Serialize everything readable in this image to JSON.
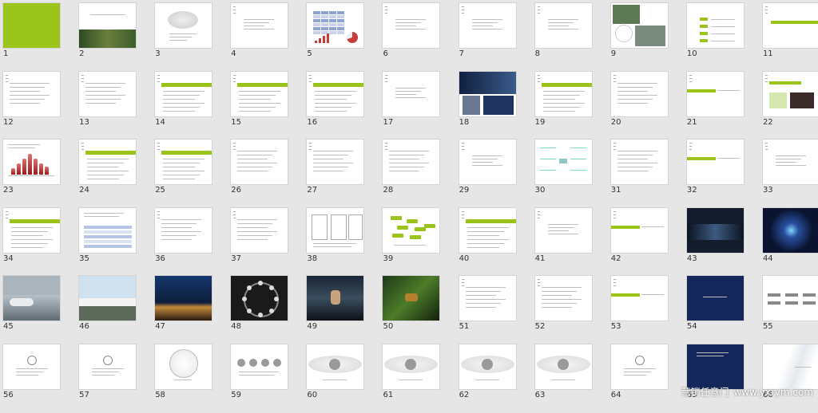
{
  "slides": [
    {
      "num": "1",
      "kind": "green"
    },
    {
      "num": "2",
      "kind": "cover-photo"
    },
    {
      "num": "3",
      "kind": "eye"
    },
    {
      "num": "4",
      "kind": "text-center"
    },
    {
      "num": "5",
      "kind": "table-chart"
    },
    {
      "num": "6",
      "kind": "text-center"
    },
    {
      "num": "7",
      "kind": "text-center"
    },
    {
      "num": "8",
      "kind": "text-center"
    },
    {
      "num": "9",
      "kind": "photo-collage"
    },
    {
      "num": "10",
      "kind": "contents"
    },
    {
      "num": "11",
      "kind": "bar-right"
    },
    {
      "num": "12",
      "kind": "text-left"
    },
    {
      "num": "13",
      "kind": "text-left"
    },
    {
      "num": "14",
      "kind": "title-bar"
    },
    {
      "num": "15",
      "kind": "title-bar"
    },
    {
      "num": "16",
      "kind": "title-bar"
    },
    {
      "num": "17",
      "kind": "text-center"
    },
    {
      "num": "18",
      "kind": "photo-collage-blue"
    },
    {
      "num": "19",
      "kind": "title-bar"
    },
    {
      "num": "20",
      "kind": "text-left"
    },
    {
      "num": "21",
      "kind": "bar-left"
    },
    {
      "num": "22",
      "kind": "title-bar-img"
    },
    {
      "num": "23",
      "kind": "red-chart"
    },
    {
      "num": "24",
      "kind": "title-bar"
    },
    {
      "num": "25",
      "kind": "title-bar"
    },
    {
      "num": "26",
      "kind": "text-left"
    },
    {
      "num": "27",
      "kind": "text-left"
    },
    {
      "num": "28",
      "kind": "text-left"
    },
    {
      "num": "29",
      "kind": "text-center"
    },
    {
      "num": "30",
      "kind": "mindmap"
    },
    {
      "num": "31",
      "kind": "text-left"
    },
    {
      "num": "32",
      "kind": "bar-left"
    },
    {
      "num": "33",
      "kind": "text-center"
    },
    {
      "num": "34",
      "kind": "title-bar"
    },
    {
      "num": "35",
      "kind": "table-blue"
    },
    {
      "num": "36",
      "kind": "text-left"
    },
    {
      "num": "37",
      "kind": "text-left"
    },
    {
      "num": "38",
      "kind": "diagram"
    },
    {
      "num": "39",
      "kind": "green-boxes"
    },
    {
      "num": "40",
      "kind": "title-bar"
    },
    {
      "num": "41",
      "kind": "text-center"
    },
    {
      "num": "42",
      "kind": "bar-left"
    },
    {
      "num": "43",
      "kind": "dark-photo"
    },
    {
      "num": "44",
      "kind": "dark-light"
    },
    {
      "num": "45",
      "kind": "car-photo"
    },
    {
      "num": "46",
      "kind": "train-photo"
    },
    {
      "num": "47",
      "kind": "night-photo"
    },
    {
      "num": "48",
      "kind": "clock"
    },
    {
      "num": "49",
      "kind": "spa-photo"
    },
    {
      "num": "50",
      "kind": "jungle-photo"
    },
    {
      "num": "51",
      "kind": "text-left"
    },
    {
      "num": "52",
      "kind": "text-left"
    },
    {
      "num": "53",
      "kind": "bar-left"
    },
    {
      "num": "54",
      "kind": "navy"
    },
    {
      "num": "55",
      "kind": "logos"
    },
    {
      "num": "56",
      "kind": "logo-center"
    },
    {
      "num": "57",
      "kind": "logo-center"
    },
    {
      "num": "58",
      "kind": "emblem"
    },
    {
      "num": "59",
      "kind": "four-circles"
    },
    {
      "num": "60",
      "kind": "gray-ellipse"
    },
    {
      "num": "61",
      "kind": "gray-ellipse"
    },
    {
      "num": "62",
      "kind": "gray-ellipse"
    },
    {
      "num": "63",
      "kind": "gray-ellipse"
    },
    {
      "num": "64",
      "kind": "logo-center"
    },
    {
      "num": "65",
      "kind": "navy-text"
    },
    {
      "num": "66",
      "kind": "white-curve"
    }
  ],
  "watermark": {
    "brand": "营销任意门",
    "url": "www.yxrym.com"
  },
  "colors": {
    "accent": "#9bc41b",
    "background": "#e6e6e6",
    "navy": "#14265a"
  }
}
